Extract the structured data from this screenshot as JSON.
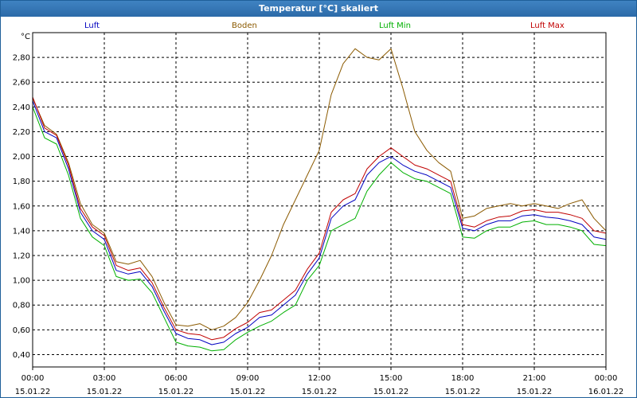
{
  "window": {
    "title": "Temperatur [°C] skaliert"
  },
  "chart_data": {
    "type": "line",
    "title": "Temperatur [°C] skaliert",
    "ylabel": "°C",
    "xlabel": "",
    "ylim": [
      0.3,
      3.0
    ],
    "yticks": [
      0.4,
      0.6,
      0.8,
      1.0,
      1.2,
      1.4,
      1.6,
      1.8,
      2.0,
      2.2,
      2.4,
      2.6,
      2.8
    ],
    "ytick_labels": [
      "0,40",
      "0,60",
      "0,80",
      "1,00",
      "1,20",
      "1,40",
      "1,60",
      "1,80",
      "2,00",
      "2,20",
      "2,40",
      "2,60",
      "2,80"
    ],
    "xlim": [
      0,
      24
    ],
    "xticks": [
      0,
      3,
      6,
      9,
      12,
      15,
      18,
      21,
      24
    ],
    "xtick_labels": [
      {
        "time": "00:00",
        "date": "15.01.22"
      },
      {
        "time": "03:00",
        "date": "15.01.22"
      },
      {
        "time": "06:00",
        "date": "15.01.22"
      },
      {
        "time": "09:00",
        "date": "15.01.22"
      },
      {
        "time": "12:00",
        "date": "15.01.22"
      },
      {
        "time": "15:00",
        "date": "15.01.22"
      },
      {
        "time": "18:00",
        "date": "15.01.22"
      },
      {
        "time": "21:00",
        "date": "15.01.22"
      },
      {
        "time": "00:00",
        "date": "16.01.22"
      }
    ],
    "grid": true,
    "legend_position": "top",
    "series": [
      {
        "name": "Luft",
        "color": "#0000c0",
        "x": [
          0,
          0.5,
          1,
          1.5,
          2,
          2.5,
          3,
          3.5,
          4,
          4.5,
          5,
          5.5,
          6,
          6.5,
          7,
          7.5,
          8,
          8.5,
          9,
          9.5,
          10,
          10.5,
          11,
          11.5,
          12,
          12.5,
          13,
          13.5,
          14,
          14.5,
          15,
          15.5,
          16,
          16.5,
          17,
          17.5,
          18,
          18.5,
          19,
          19.5,
          20,
          20.5,
          21,
          21.5,
          22,
          22.5,
          23,
          23.5,
          24
        ],
        "y": [
          2.45,
          2.2,
          2.15,
          1.9,
          1.55,
          1.4,
          1.33,
          1.08,
          1.05,
          1.07,
          0.95,
          0.75,
          0.57,
          0.53,
          0.52,
          0.48,
          0.5,
          0.57,
          0.62,
          0.7,
          0.72,
          0.8,
          0.88,
          1.05,
          1.18,
          1.5,
          1.6,
          1.65,
          1.85,
          1.95,
          2.0,
          1.93,
          1.88,
          1.85,
          1.8,
          1.75,
          1.42,
          1.4,
          1.45,
          1.48,
          1.48,
          1.52,
          1.53,
          1.51,
          1.5,
          1.48,
          1.45,
          1.35,
          1.33
        ]
      },
      {
        "name": "Boden",
        "color": "#8b5a00",
        "x": [
          0,
          0.5,
          1,
          1.5,
          2,
          2.5,
          3,
          3.5,
          4,
          4.5,
          5,
          5.5,
          6,
          6.5,
          7,
          7.5,
          8,
          8.5,
          9,
          9.5,
          10,
          10.5,
          11,
          11.5,
          12,
          12.5,
          13,
          13.5,
          14,
          14.5,
          15,
          15.5,
          16,
          16.5,
          17,
          17.5,
          18,
          18.5,
          19,
          19.5,
          20,
          20.5,
          21,
          21.5,
          22,
          22.5,
          23,
          23.5,
          24
        ],
        "y": [
          2.47,
          2.25,
          2.18,
          1.95,
          1.62,
          1.45,
          1.38,
          1.15,
          1.13,
          1.16,
          1.03,
          0.82,
          0.64,
          0.63,
          0.65,
          0.6,
          0.63,
          0.7,
          0.82,
          1.0,
          1.2,
          1.45,
          1.65,
          1.85,
          2.05,
          2.5,
          2.75,
          2.87,
          2.8,
          2.78,
          2.87,
          2.55,
          2.2,
          2.05,
          1.95,
          1.88,
          1.5,
          1.52,
          1.58,
          1.6,
          1.62,
          1.6,
          1.62,
          1.6,
          1.58,
          1.62,
          1.65,
          1.5,
          1.4
        ]
      },
      {
        "name": "Luft Min",
        "color": "#00b000",
        "x": [
          0,
          0.5,
          1,
          1.5,
          2,
          2.5,
          3,
          3.5,
          4,
          4.5,
          5,
          5.5,
          6,
          6.5,
          7,
          7.5,
          8,
          8.5,
          9,
          9.5,
          10,
          10.5,
          11,
          11.5,
          12,
          12.5,
          13,
          13.5,
          14,
          14.5,
          15,
          15.5,
          16,
          16.5,
          17,
          17.5,
          18,
          18.5,
          19,
          19.5,
          20,
          20.5,
          21,
          21.5,
          22,
          22.5,
          23,
          23.5,
          24
        ],
        "y": [
          2.4,
          2.15,
          2.1,
          1.85,
          1.5,
          1.35,
          1.28,
          1.03,
          1.0,
          1.01,
          0.9,
          0.7,
          0.5,
          0.47,
          0.46,
          0.43,
          0.44,
          0.52,
          0.58,
          0.63,
          0.67,
          0.74,
          0.8,
          1.0,
          1.12,
          1.4,
          1.45,
          1.5,
          1.72,
          1.85,
          1.95,
          1.87,
          1.82,
          1.8,
          1.75,
          1.7,
          1.35,
          1.34,
          1.4,
          1.43,
          1.43,
          1.47,
          1.48,
          1.45,
          1.45,
          1.43,
          1.4,
          1.29,
          1.28
        ]
      },
      {
        "name": "Luft Max",
        "color": "#c00000",
        "x": [
          0,
          0.5,
          1,
          1.5,
          2,
          2.5,
          3,
          3.5,
          4,
          4.5,
          5,
          5.5,
          6,
          6.5,
          7,
          7.5,
          8,
          8.5,
          9,
          9.5,
          10,
          10.5,
          11,
          11.5,
          12,
          12.5,
          13,
          13.5,
          14,
          14.5,
          15,
          15.5,
          16,
          16.5,
          17,
          17.5,
          18,
          18.5,
          19,
          19.5,
          20,
          20.5,
          21,
          21.5,
          22,
          22.5,
          23,
          23.5,
          24
        ],
        "y": [
          2.48,
          2.23,
          2.17,
          1.93,
          1.58,
          1.43,
          1.36,
          1.12,
          1.08,
          1.1,
          0.98,
          0.78,
          0.6,
          0.57,
          0.56,
          0.52,
          0.54,
          0.61,
          0.66,
          0.74,
          0.76,
          0.84,
          0.92,
          1.09,
          1.22,
          1.55,
          1.65,
          1.7,
          1.9,
          2.0,
          2.07,
          2.0,
          1.93,
          1.9,
          1.85,
          1.8,
          1.45,
          1.43,
          1.48,
          1.51,
          1.52,
          1.56,
          1.57,
          1.55,
          1.55,
          1.53,
          1.5,
          1.4,
          1.38
        ]
      }
    ]
  }
}
